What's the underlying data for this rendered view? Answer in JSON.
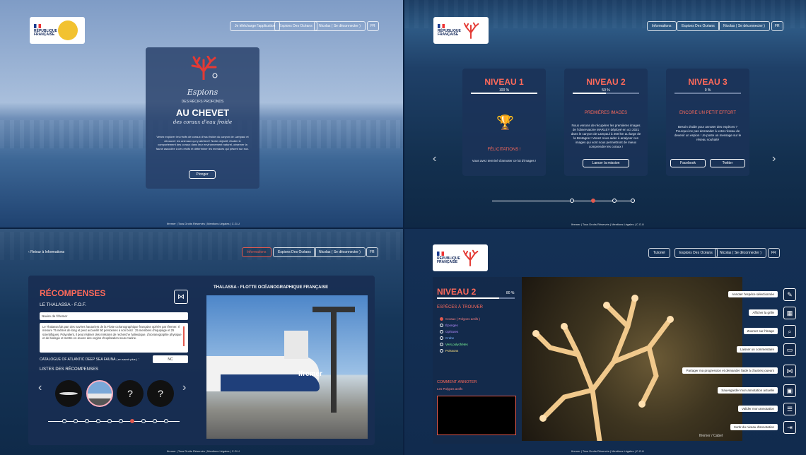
{
  "q1": {
    "nav": [
      "Je télécharge l'application",
      "Espions Des Océans",
      "Nicolas ( Se déconnecter )",
      "FR"
    ],
    "brand": {
      "title_line1": "Espions",
      "title_line2": "DES RÉCIFS PROFONDS"
    },
    "headline": "AU CHEVET",
    "subheadline": "des coraux d'eau froide",
    "body": "Venez explorer les récifs de coraux d'eau froide du canyon de Lampaul et découvrir les animaux qui y abritent ! Notre objectif, étudier le comportement des coraux dans leur environnement naturel, observer la faune associée à ces récifs et déterminer les menaces qui pèsent sur eux.",
    "cta": "Plonger",
    "footer": "Ifremer | Tous Droits Réservés | Mentions Légales | C.G.U"
  },
  "q2": {
    "nav": [
      "Informations",
      "Espions Des Océans",
      "Nicolas ( Se déconnecter )",
      "FR"
    ],
    "levels": [
      {
        "title": "NIVEAU 1",
        "pct": "100 %",
        "progress": 1.0,
        "heading": "FÉLICITATIONS !",
        "body": "Vous avez terminé d'annoter ce lot d'images !",
        "buttons": []
      },
      {
        "title": "NIVEAU 2",
        "pct": "50 %",
        "progress": 0.5,
        "heading": "PREMIÈRES IMAGES",
        "body": "Nous venons de récupérer les premières images de l'observatoire MARLEY déployé en oct 2021 dans le canyon de Lampaul à 250 km au large de la Bretagne ! Venez nous aider à analyser ces images qui vont nous permettront de mieux comprendre les coraux !",
        "buttons": [
          "Lancer la mission"
        ]
      },
      {
        "title": "NIVEAU 3",
        "pct": "0 %",
        "progress": 0.0,
        "heading": "ENCORE UN PETIT EFFORT",
        "body": "Besoin d'aide pour annoter des espèces ? Pourquoi ne pas demander à votre réseau de devenir un espion ! Je poste un message sur le réseau souhaité",
        "buttons": [
          "Facebook",
          "Twitter"
        ]
      }
    ],
    "footer": "Ifremer | Tous Droits Réservés | Mentions Légales | C.G.U"
  },
  "q3": {
    "back": "Retour à Informations",
    "nav": [
      "Informations",
      "Espions Des Océans",
      "Nicolas ( Se déconnecter )",
      "FR"
    ],
    "title": "RÉCOMPENSES",
    "subtitle": "LE THALASSA - F.O.F.",
    "field": "Navire de l'ifremer",
    "description": "Le Thalassa fait part des navires hauturiers de la Flotte océanographique française opérée par Ifremer. Il mesure 75 mètres de long et peut accueillir 50 personnes à son bord : 25 membres d'équipage et 25 scientifiques. Polyvalent, il peut réaliser des missions de recherche halieutique, d'océanographie physique et de biologie et mettre en œuvre des engins d'exploration sous-marine.",
    "catalogue": "CATALOGUE OF ATLANTIC DEEP SEA FAUNA",
    "catalogue_link": "( en savoir plus )",
    "catalogue_value": "NC",
    "list_title": "LISTES DES RÉCOMPENSES",
    "mystery": "?",
    "photo_title": "THALASSA - FLOTTE OCÉANOGRAPHIQUE FRANÇAISE",
    "ship_label": "Ifremer",
    "footer": "Ifremer | Tous Droits Réservés | Mentions Légales | C.G.U"
  },
  "q4": {
    "nav": [
      "Tutoriel",
      "Espions Des Océans",
      "Nicolas ( Se déconnecter )",
      "FR"
    ],
    "level": "NIVEAU 2",
    "pct": "80 %",
    "species_title": "ESPÈCES À TROUVER",
    "species": [
      {
        "name": "Coraux ( Polypes actifs )",
        "color": "#ff8080"
      },
      {
        "name": "Éponges",
        "color": "#b58cff"
      },
      {
        "name": "Ophiures",
        "color": "#b58cff"
      },
      {
        "name": "Crabe",
        "color": "#7fb6ff"
      },
      {
        "name": "Vers polychètes",
        "color": "#7fff9a"
      },
      {
        "name": "Poissons",
        "color": "#ffe27f"
      }
    ],
    "how_title": "COMMENT ANNOTER",
    "how_text": "Les Polypes actifs",
    "tools": [
      {
        "label": "Annoter l'espèce sélectionnée",
        "icon": "pencil-icon",
        "glyph": "✎"
      },
      {
        "label": "Afficher la grille",
        "icon": "grid-icon",
        "glyph": "▦"
      },
      {
        "label": "Zoomer sur l'image",
        "icon": "zoom-icon",
        "glyph": "⌕"
      },
      {
        "label": "Laisser un commentaire",
        "icon": "comment-icon",
        "glyph": "▭"
      },
      {
        "label": "Partager ma progression et demander l'aide à d'autres joueurs",
        "icon": "share-icon",
        "glyph": "⋈"
      },
      {
        "label": "Sauvegarder mon annotation actuelle",
        "icon": "save-icon",
        "glyph": "▣"
      },
      {
        "label": "Valider mon annotation",
        "icon": "validate-icon",
        "glyph": "☰"
      },
      {
        "label": "Sortir du niveau d'annotation",
        "icon": "exit-icon",
        "glyph": "⇥"
      }
    ],
    "watermark": "Ifremer / Cabel",
    "footer": "Ifremer | Tous Droits Réservés | Mentions Légales | C.G.U"
  }
}
